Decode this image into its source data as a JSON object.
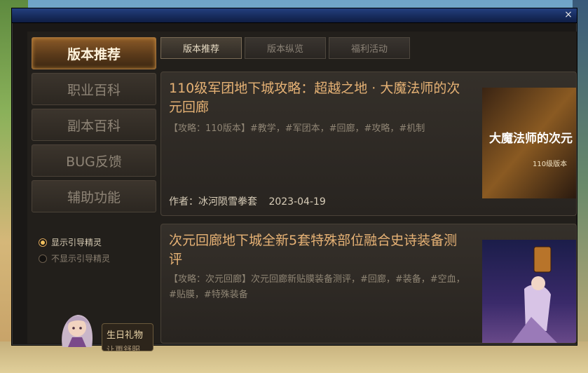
{
  "window": {
    "close_glyph": "×"
  },
  "sidebar": {
    "items": [
      {
        "label": "版本推荐",
        "active": true
      },
      {
        "label": "职业百科",
        "active": false
      },
      {
        "label": "副本百科",
        "active": false
      },
      {
        "label": "BUG反馈",
        "active": false
      },
      {
        "label": "辅助功能",
        "active": false
      }
    ],
    "guide_options": [
      {
        "label": "显示引导精灵",
        "selected": true
      },
      {
        "label": "不显示引导精灵",
        "selected": false
      }
    ],
    "gift": {
      "label": "生日礼物",
      "sub": "让更舒服"
    }
  },
  "tabs": [
    {
      "label": "版本推荐",
      "active": true
    },
    {
      "label": "版本纵览",
      "active": false
    },
    {
      "label": "福利活动",
      "active": false
    }
  ],
  "articles": [
    {
      "title": "110级军团地下城攻略：超越之地 · 大魔法师的次元回廊",
      "tags": "【攻略：110版本】#教学，#军团本，#回廊，#攻略，#机制",
      "author": "作者：冰河陨雪拳套",
      "date": "2023-04-19",
      "thumb_text": "大魔法师的次元",
      "thumb_sub": "110级版本"
    },
    {
      "title": "次元回廊地下城全新5套特殊部位融合史诗装备测评",
      "tags": "【攻略：次元回廊】次元回廊新贴膜装备测评，#回廊，#装备，#空血，#贴膜，#特殊装备"
    }
  ],
  "colors": {
    "accent": "#e6b275",
    "active_tab": "#8a5a28",
    "title_bar": "#1c356e"
  }
}
